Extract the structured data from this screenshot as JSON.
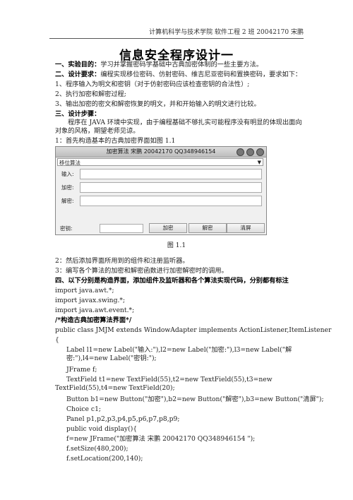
{
  "header": "计算机科学与技术学院 软件工程 2 班 20042170 宋鹏",
  "title": "信息安全程序设计一",
  "sections": {
    "objective_label": "一、实验目的：",
    "objective_text": "学习并掌握密码学基础中古典加密体制的一些主要方法。",
    "req_label": "二、设计要求：",
    "req_text": "编程实现移位密码、仿射密码、维吉尼亚密码和置换密码，要求如下：",
    "req_1": "1、程序输入为明文和密钥（对于仿射密码应该检查密钥的合法性）;",
    "req_2": "2、执行加密和解密过程;",
    "req_3": "3、输出加密的密文和解密恢复的明文，并和开始输入的明文进行比较。",
    "steps_label": "三、设计步骤：",
    "steps_intro": "程序在 JAVA 环境中实现，由于编程基础不够扎实可能程序没有明显的体现出面向对象的风格，期望老师见谅。",
    "step_1": "1：首先构造基本的古典加密界面如图 1.1",
    "figure_caption": "图 1.1",
    "step_2": "2：然后添加界面所用到的组件和注册监听器。",
    "step_3": "3：编写各个算法的加密和解密函数进行加密解密时的调用。",
    "section4": "四、以下分别是构造界面，添加组件及监听器和各个算法实现代码，分别都有标注"
  },
  "window": {
    "title": "加密算法 宋鹏 20042170 QQ348946154",
    "dropdown_value": "移位算法",
    "input_label": "输入:",
    "encrypt_label": "加密:",
    "decrypt_label": "解密:",
    "key_label": "密钥:",
    "btn_encrypt": "加密",
    "btn_decrypt": "解密",
    "btn_clear": "清屏"
  },
  "code": [
    "import java.awt.*;",
    "import javax.swing.*;",
    "import java.awt.event.*;",
    "/*构造古典加密算法界面*/",
    "public class JMJM extends WindowAdapter implements ActionListener,ItemListener",
    "{",
    "Label l1=new Label(\"输入:\"),l2=new Label(\"加密:\"),l3=new Label(\"解密:\"),l4=new Label(\"密钥:\");",
    "JFrame f;",
    "TextField t1=new TextField(55),t2=new TextField(55),t3=new TextField(55),t4=new TextField(20);",
    "Button b1=new Button(\"加密\"),b2=new Button(\"解密\"),b3=new Button(\"清屏\");",
    "Choice c1;",
    "Panel p1,p2,p3,p4,p5,p6,p7,p8,p9;",
    "public void display(){",
    "f=new JFrame(\"加密算法 宋鹏 20042170 QQ348946154 \");",
    "f.setSize(480,200);",
    "f.setLocation(200,140);"
  ]
}
